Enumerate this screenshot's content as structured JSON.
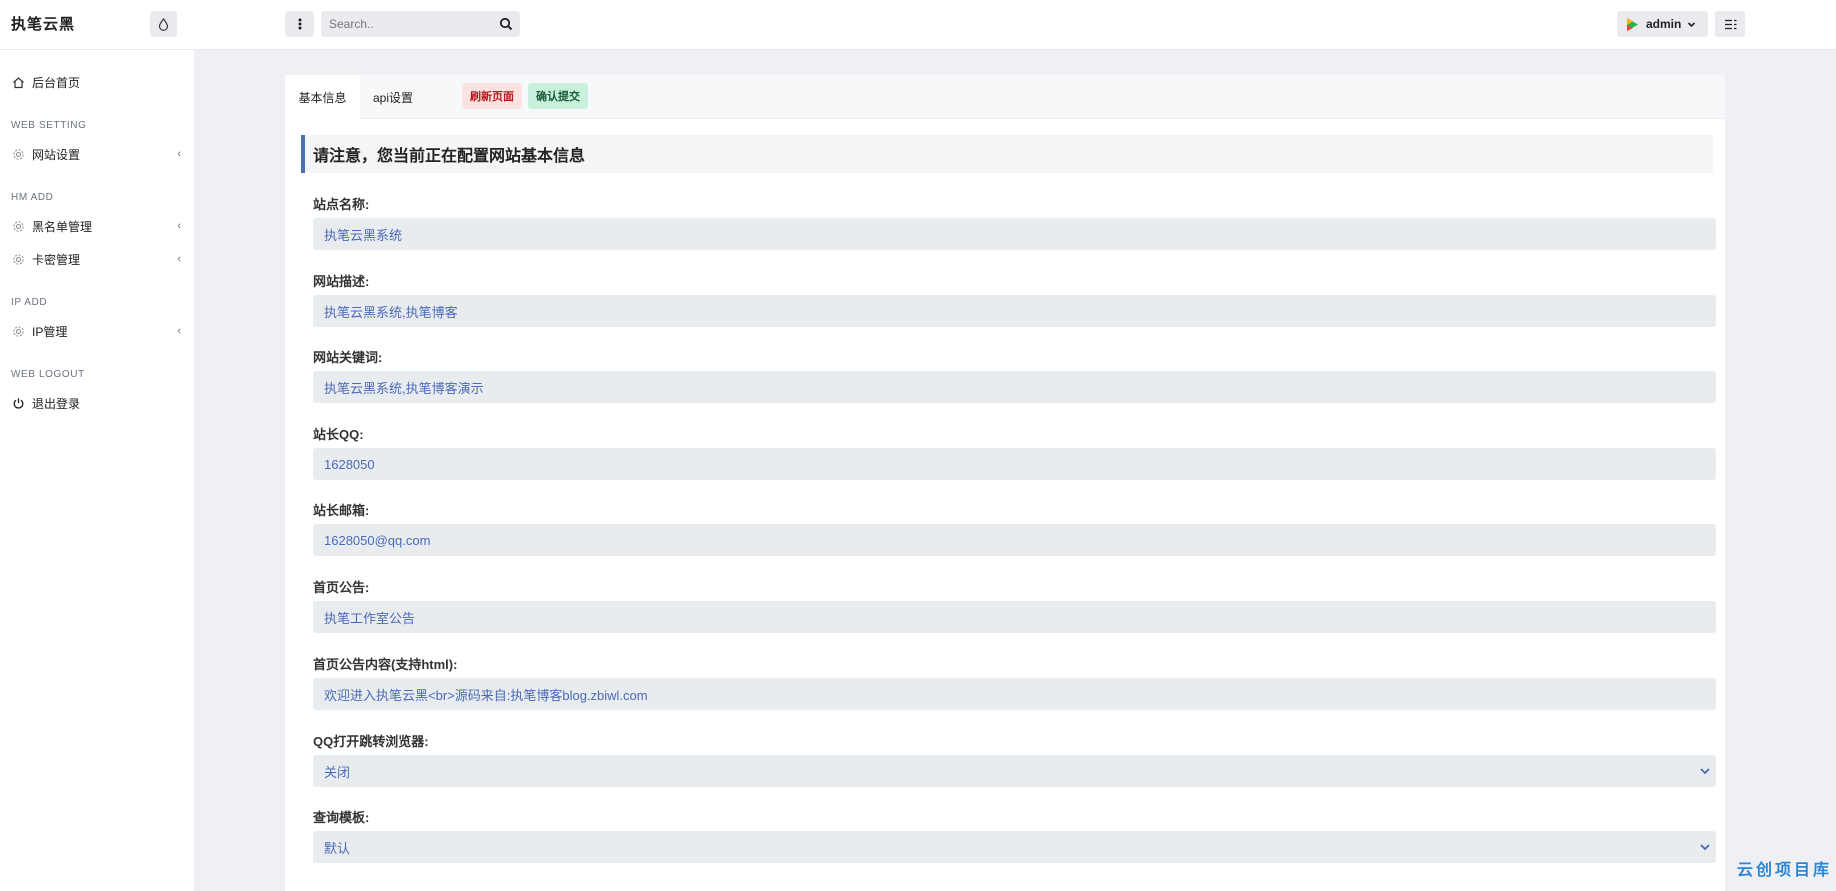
{
  "app": {
    "brand": "执笔云黑"
  },
  "topbar": {
    "search_placeholder": "Search..",
    "user_name": "admin"
  },
  "sidebar": {
    "home": "后台首页",
    "sections": [
      {
        "heading": "WEB SETTING",
        "items": [
          "网站设置"
        ]
      },
      {
        "heading": "HM ADD",
        "items": [
          "黑名单管理",
          "卡密管理"
        ]
      },
      {
        "heading": "IP ADD",
        "items": [
          "IP管理"
        ]
      },
      {
        "heading": "WEB LOGOUT",
        "items": [
          "退出登录"
        ]
      }
    ]
  },
  "card": {
    "tabs": [
      "基本信息",
      "api设置"
    ],
    "refresh_label": "刷新页面",
    "submit_label": "确认提交",
    "notice": "请注意，您当前正在配置网站基本信息",
    "fields": [
      {
        "label": "站点名称:",
        "value": "执笔云黑系统"
      },
      {
        "label": "网站描述:",
        "value": "执笔云黑系统,执笔博客"
      },
      {
        "label": "网站关键词:",
        "value": "执笔云黑系统,执笔博客演示"
      },
      {
        "label": "站长QQ:",
        "value": "1628050"
      },
      {
        "label": "站长邮箱:",
        "value": "1628050@qq.com"
      },
      {
        "label": "首页公告:",
        "value": "执笔工作室公告"
      },
      {
        "label": "首页公告内容(支持html):",
        "value": "欢迎进入执笔云黑<br>源码来自:执笔博客blog.zbiwl.com"
      },
      {
        "label": "QQ打开跳转浏览器:",
        "value": "关闭"
      },
      {
        "label": "查询模板:",
        "value": "默认"
      }
    ]
  },
  "watermark": "云创项目库",
  "colors": {
    "accent": "#4a6fb5",
    "value_text": "#4a6ab8",
    "danger_bg": "#fde2e2",
    "success_bg": "#c8f0dc"
  }
}
